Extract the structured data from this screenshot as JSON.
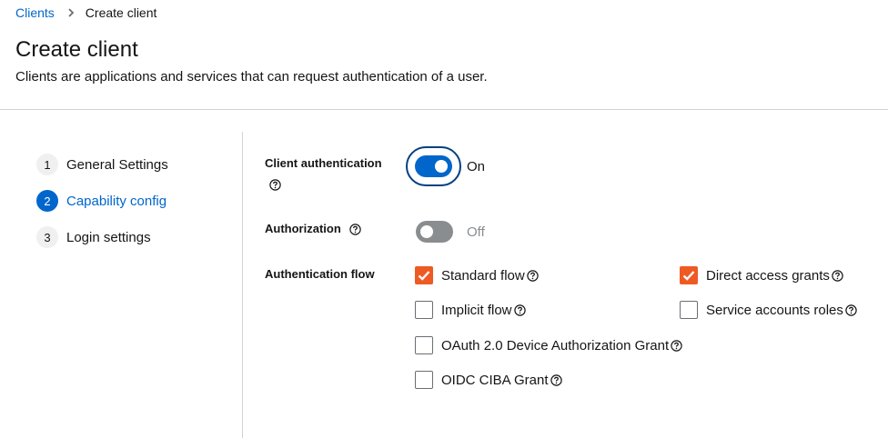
{
  "breadcrumb": {
    "link": "Clients",
    "current": "Create client"
  },
  "page": {
    "title": "Create client",
    "description": "Clients are applications and services that can request authentication of a user."
  },
  "wizard": {
    "steps": [
      {
        "num": "1",
        "label": "General Settings"
      },
      {
        "num": "2",
        "label": "Capability config",
        "current": true
      },
      {
        "num": "3",
        "label": "Login settings"
      }
    ]
  },
  "form": {
    "client_authentication": {
      "label": "Client authentication",
      "state": "On",
      "enabled": true
    },
    "authorization": {
      "label": "Authorization",
      "state": "Off",
      "enabled": false
    },
    "authentication_flow": {
      "label": "Authentication flow",
      "options": [
        {
          "label": "Standard flow",
          "checked": true
        },
        {
          "label": "Direct access grants",
          "checked": true
        },
        {
          "label": "Implicit flow",
          "checked": false
        },
        {
          "label": "Service accounts roles",
          "checked": false
        },
        {
          "label": "OAuth 2.0 Device Authorization Grant",
          "checked": false
        },
        {
          "label": "OIDC CIBA Grant",
          "checked": false
        }
      ]
    }
  },
  "colors": {
    "link": "#0066cc",
    "switch_on": "#0066cc",
    "switch_off": "#8a8d90",
    "checkbox_checked": "#ee5a24",
    "divider": "#d2d2d2"
  },
  "icons": {
    "breadcrumb_separator": "chevron-right-icon",
    "help": "help-circle-icon",
    "check": "check-icon"
  }
}
